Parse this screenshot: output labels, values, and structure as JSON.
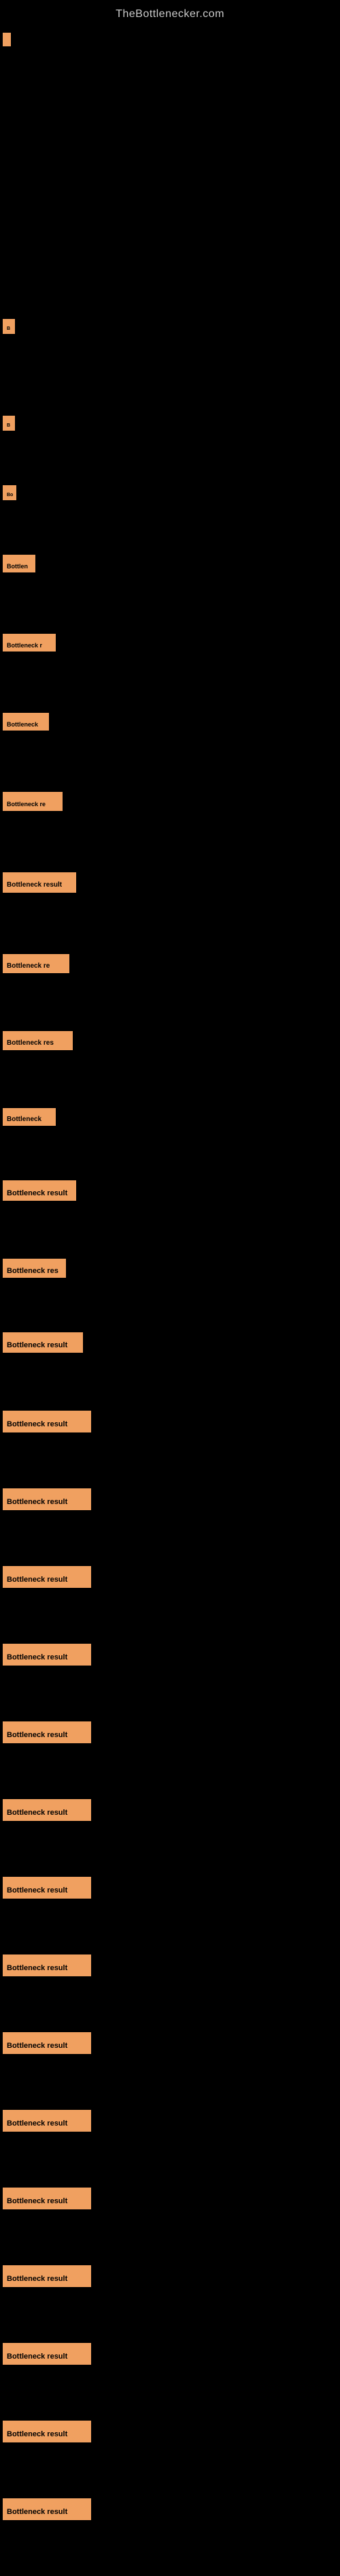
{
  "site": {
    "title": "TheBottlenecker.com"
  },
  "bars": [
    {
      "id": 1,
      "label": "",
      "height": 20
    },
    {
      "id": 2,
      "label": "B",
      "height": 22
    },
    {
      "id": 3,
      "label": "B",
      "height": 22
    },
    {
      "id": 4,
      "label": "Bo",
      "height": 22
    },
    {
      "id": 5,
      "label": "Bottlen",
      "height": 26
    },
    {
      "id": 6,
      "label": "Bottleneck r",
      "height": 26
    },
    {
      "id": 7,
      "label": "Bottleneck",
      "height": 26
    },
    {
      "id": 8,
      "label": "Bottleneck re",
      "height": 28
    },
    {
      "id": 9,
      "label": "Bottleneck result",
      "height": 30
    },
    {
      "id": 10,
      "label": "Bottleneck re",
      "height": 28
    },
    {
      "id": 11,
      "label": "Bottleneck res",
      "height": 28
    },
    {
      "id": 12,
      "label": "Bottleneck",
      "height": 26
    },
    {
      "id": 13,
      "label": "Bottleneck result",
      "height": 30
    },
    {
      "id": 14,
      "label": "Bottleneck res",
      "height": 28
    },
    {
      "id": 15,
      "label": "Bottleneck result",
      "height": 30
    },
    {
      "id": 16,
      "label": "Bottleneck result",
      "height": 32
    },
    {
      "id": 17,
      "label": "Bottleneck result",
      "height": 32
    },
    {
      "id": 18,
      "label": "Bottleneck result",
      "height": 32
    },
    {
      "id": 19,
      "label": "Bottleneck result",
      "height": 32
    },
    {
      "id": 20,
      "label": "Bottleneck result",
      "height": 32
    },
    {
      "id": 21,
      "label": "Bottleneck result",
      "height": 32
    },
    {
      "id": 22,
      "label": "Bottleneck result",
      "height": 32
    },
    {
      "id": 23,
      "label": "Bottleneck result",
      "height": 32
    },
    {
      "id": 24,
      "label": "Bottleneck result",
      "height": 32
    },
    {
      "id": 25,
      "label": "Bottleneck result",
      "height": 32
    },
    {
      "id": 26,
      "label": "Bottleneck result",
      "height": 32
    },
    {
      "id": 27,
      "label": "Bottleneck result",
      "height": 32
    },
    {
      "id": 28,
      "label": "Bottleneck result",
      "height": 32
    },
    {
      "id": 29,
      "label": "Bottleneck result",
      "height": 32
    },
    {
      "id": 30,
      "label": "Bottleneck result",
      "height": 32
    }
  ]
}
